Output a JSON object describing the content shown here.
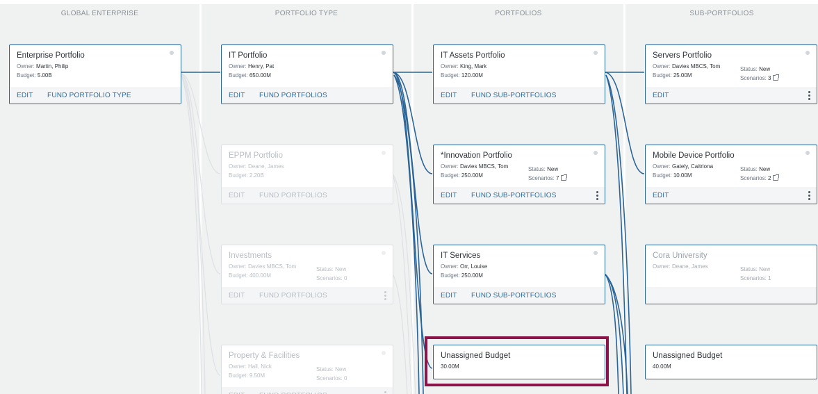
{
  "columns": {
    "global": "GLOBAL ENTERPRISE",
    "portfolio_type": "PORTFOLIO TYPE",
    "portfolios": "PORTFOLIOS",
    "sub_portfolios": "SUB-PORTFOLIOS"
  },
  "labels": {
    "owner": "Owner:",
    "budget": "Budget:",
    "status": "Status:",
    "scenarios": "Scenarios:",
    "edit": "EDIT",
    "fund_portfolio_type": "FUND PORTFOLIO TYPE",
    "fund_portfolios": "FUND PORTFOLIOS",
    "fund_sub_portfolios": "FUND SUB-PORTFOLIOS"
  },
  "cards": {
    "enterprise": {
      "title": "Enterprise Portfolio",
      "owner": "Martin, Philip",
      "budget": "5.00B"
    },
    "it_portfolio": {
      "title": "IT Portfolio",
      "owner": "Henry, Pat",
      "budget": "650.00M"
    },
    "eppm": {
      "title": "EPPM Portfolio",
      "owner": "Deane, James",
      "budget": "2.20B"
    },
    "investments": {
      "title": "Investments",
      "owner": "Davies MBCS, Tom",
      "budget": "400.00M",
      "status": "New",
      "scenarios": "0"
    },
    "property": {
      "title": "Property & Facilities",
      "owner": "Hall, Nick",
      "budget": "9.50M",
      "status": "New",
      "scenarios": "0"
    },
    "it_assets": {
      "title": "IT Assets Portfolio",
      "owner": "King, Mark",
      "budget": "120.00M"
    },
    "innovation": {
      "title": "*Innovation Portfolio",
      "owner": "Davies MBCS, Tom",
      "budget": "250.00M",
      "status": "New",
      "scenarios": "7"
    },
    "it_services": {
      "title": "IT Services",
      "owner": "Orr, Louise",
      "budget": "250.00M"
    },
    "unassigned_portfolios": {
      "title": "Unassigned Budget",
      "amount": "30.00M"
    },
    "servers": {
      "title": "Servers Portfolio",
      "owner": "Davies MBCS, Tom",
      "budget": "25.00M",
      "status": "New",
      "scenarios": "3"
    },
    "mobile": {
      "title": "Mobile Device Portfolio",
      "owner": "Gately, Caitriona",
      "budget": "10.00M",
      "status": "New",
      "scenarios": "2"
    },
    "cora": {
      "title": "Cora University",
      "owner": "Deane, James",
      "status": "New",
      "scenarios": "1"
    },
    "unassigned_sub": {
      "title": "Unassigned Budget",
      "amount": "40.00M"
    }
  },
  "colors": {
    "link": "#2b6496",
    "dim_link": "#dfe2e5",
    "highlight": "#8b1448"
  }
}
